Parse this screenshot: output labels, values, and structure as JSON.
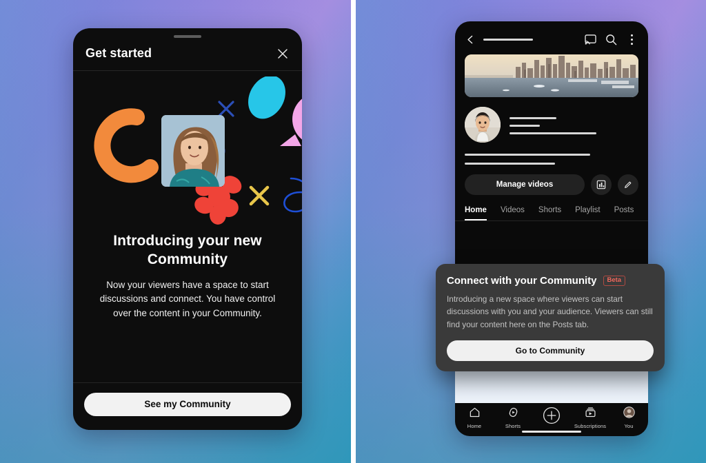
{
  "left_panel": {
    "sheet": {
      "title": "Get started",
      "close_icon": "close-icon",
      "heading": "Introducing your new Community",
      "body": "Now your viewers have a space to start discussions and connect. You have control over the content in your Community.",
      "cta_label": "See my Community"
    },
    "illustration": {
      "name": "community-illustration",
      "colors": {
        "orange_arc": "#F28A3C",
        "cyan_blob": "#27C6E8",
        "pink_bubble": "#F3A6E8",
        "red_flower": "#EF4338",
        "yellow_dot": "#F5CE1E",
        "pink_dot": "#EDA6E4",
        "blue_stroke": "#1E4FD6",
        "yellow_cross": "#E8C64A",
        "photo_bg": "#A9C3D6"
      }
    }
  },
  "right_panel": {
    "topbar": {
      "back_icon": "back-arrow-icon",
      "cast_icon": "cast-icon",
      "search_icon": "search-icon",
      "more_icon": "more-vertical-icon"
    },
    "banner": {
      "name": "channel-banner",
      "alt": "city skyline banner"
    },
    "avatar": {
      "name": "channel-avatar"
    },
    "actions": {
      "manage_label": "Manage videos",
      "analytics_icon": "analytics-bar-chart-icon",
      "edit_icon": "pencil-edit-icon"
    },
    "tabs": [
      {
        "label": "Home",
        "active": true
      },
      {
        "label": "Videos",
        "active": false
      },
      {
        "label": "Shorts",
        "active": false
      },
      {
        "label": "Playlist",
        "active": false
      },
      {
        "label": "Posts",
        "active": false
      }
    ],
    "dialog": {
      "title": "Connect with your Community",
      "badge": "Beta",
      "body": "Introducing a new space where viewers can start discussions with you and your audience. Viewers can still find your content here on the Posts tab.",
      "cta_label": "Go to Community",
      "badge_color": "#F2685C",
      "surface_color": "#3A3A3A"
    },
    "bottom_nav": [
      {
        "label": "Home",
        "icon": "home-icon"
      },
      {
        "label": "Shorts",
        "icon": "shorts-icon"
      },
      {
        "label": "",
        "icon": "create-plus-icon"
      },
      {
        "label": "Subscriptions",
        "icon": "subscriptions-icon"
      },
      {
        "label": "You",
        "icon": "you-avatar-icon"
      }
    ]
  },
  "theme": {
    "background_gradient_start": "#6F8FD8",
    "background_gradient_mid": "#B58EE8",
    "background_gradient_end": "#3F8FE2",
    "phone_surface": "#0B0B0B"
  }
}
